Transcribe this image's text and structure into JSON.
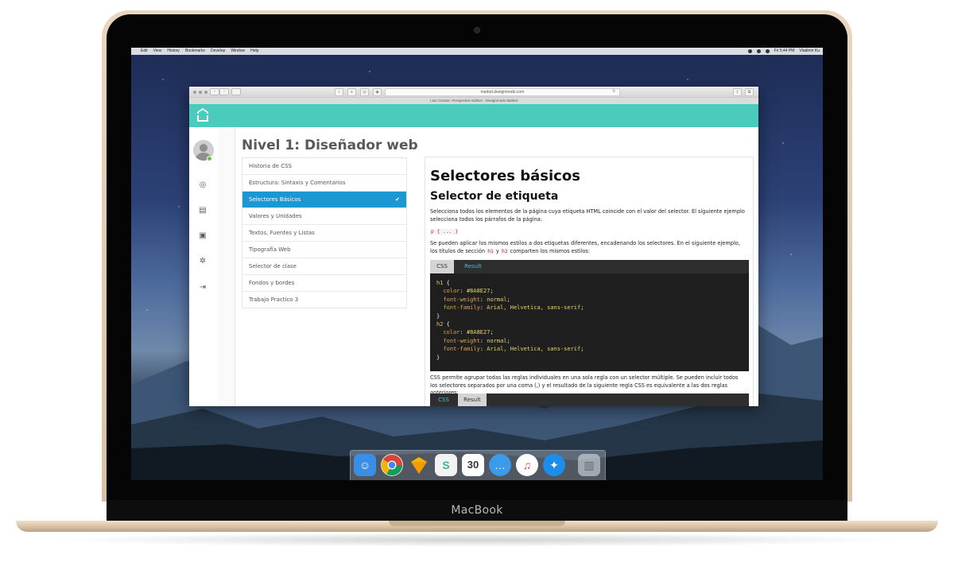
{
  "device": {
    "brand_label": "MacBook"
  },
  "menubar": {
    "items": [
      "Edit",
      "View",
      "History",
      "Bookmarks",
      "Develop",
      "Window",
      "Help"
    ],
    "clock": "Fri 5:44 PM",
    "user": "Vladimir Ku"
  },
  "browser": {
    "url": "market.designmodo.com",
    "tab_title": "I am Creator: Perspective Edition - Designmodo Market"
  },
  "app": {
    "level_title": "Nivel 1: Diseñador web",
    "lessons": [
      {
        "label": "Historia de CSS",
        "active": false
      },
      {
        "label": "Estructura: Sintaxis y Comentarios",
        "active": false
      },
      {
        "label": "Selectores Básicos",
        "active": true
      },
      {
        "label": "Valores y Unidades",
        "active": false
      },
      {
        "label": "Textos, Fuentes y Listas",
        "active": false
      },
      {
        "label": "Tipografía Web",
        "active": false
      },
      {
        "label": "Selector de clase",
        "active": false
      },
      {
        "label": "Fondos y bordes",
        "active": false
      },
      {
        "label": "Trabajo Practico 3",
        "active": false
      }
    ],
    "check_glyph": "✔"
  },
  "article": {
    "title": "Selectores básicos",
    "subtitle": "Selector de etiqueta",
    "p1": "Selecciona todos los elementos de la página cuya etiqueta HTML coincide con el valor del selector. El siguiente ejemplo selecciona todos los párrafos de la página:",
    "inline_p": "p { ... }",
    "p2_a": "Se pueden aplicar los mismos estilos a dos etiquetas diferentes, encadenando los selectores. En el siguiente ejemplo, los títulos de sección",
    "p2_h1": "h1",
    "p2_y": "y",
    "p2_h2": "h2",
    "p2_b": "comparten los mismos estilos:",
    "tabs": {
      "css": "CSS",
      "result": "Result"
    },
    "code": {
      "h1": "h1",
      "h2": "h2",
      "color_prop": "color",
      "color_val": "#8A8E27",
      "weight_prop": "font-weight",
      "weight_val": "normal",
      "family_prop": "font-family",
      "family_val": "Arial, Helvetica, sans-serif"
    },
    "p3": "CSS permite agrupar todas las reglas individuales en una sola regla con un selector múltiple. Se pueden incluir todos los selectores separados por una coma (,) y el resultado de la siguiente regla CSS es equivalente a las dos reglas anteriores:"
  },
  "dock": {
    "apps": [
      "finder-icon",
      "chrome-icon",
      "sketch-icon",
      "slack-icon",
      "calendar-icon",
      "messages-icon",
      "itunes-icon",
      "safari-icon",
      "trash-icon"
    ],
    "calendar_day": "30"
  }
}
